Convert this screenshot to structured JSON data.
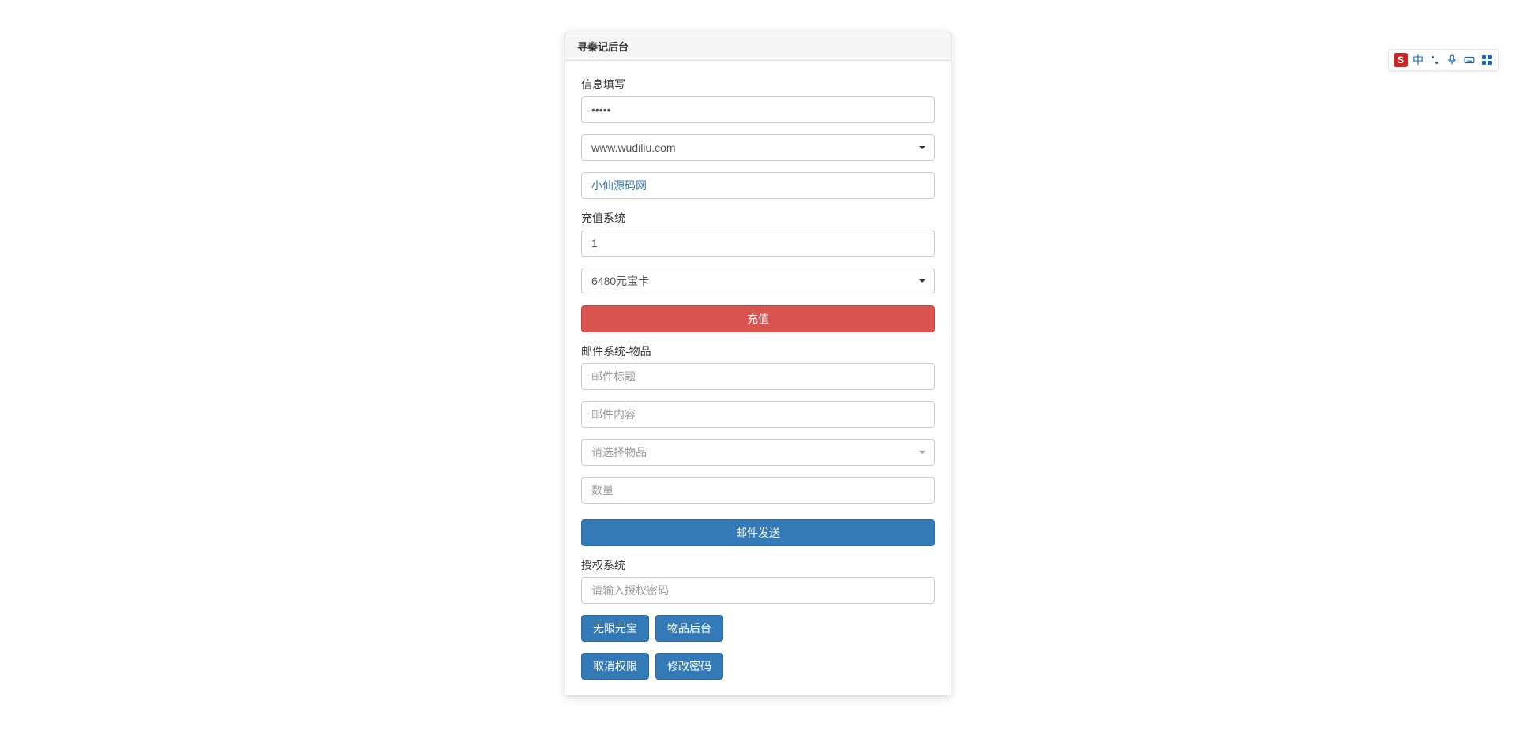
{
  "panel": {
    "title": "寻秦记后台"
  },
  "info": {
    "section_label": "信息填写",
    "password_value": "•••••",
    "server_selected": "www.wudiliu.com",
    "account_value": "小仙源码网"
  },
  "recharge": {
    "section_label": "充值系统",
    "quantity_value": "1",
    "card_selected": "6480元宝卡",
    "submit_label": "充值"
  },
  "mail": {
    "section_label": "邮件系统-物品",
    "title_placeholder": "邮件标题",
    "content_placeholder": "邮件内容",
    "item_placeholder": "请选择物品",
    "qty_placeholder": "数量",
    "submit_label": "邮件发送"
  },
  "auth": {
    "section_label": "授权系统",
    "password_placeholder": "请输入授权密码",
    "buttons": {
      "unlimited": "无限元宝",
      "item_admin": "物品后台",
      "revoke": "取消权限",
      "change_pw": "修改密码"
    }
  },
  "ime": {
    "lang": "中"
  }
}
